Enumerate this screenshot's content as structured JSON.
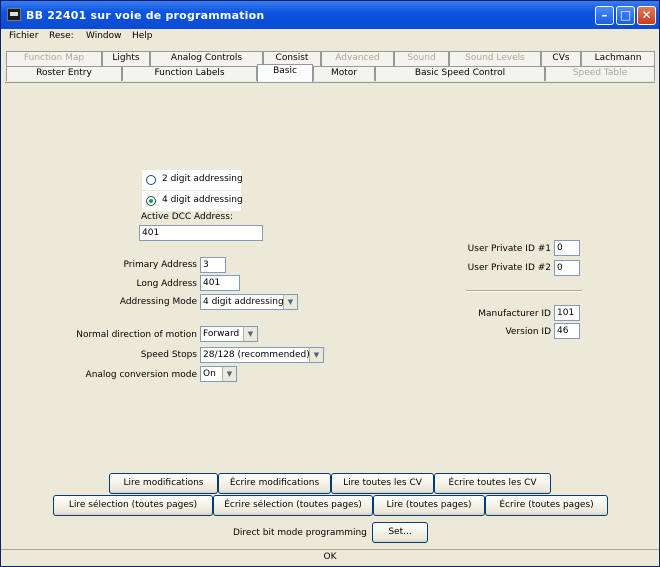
{
  "window": {
    "title": "BB 22401 sur voie de programmation"
  },
  "menu": [
    "Fichier",
    "Rese:",
    "Window",
    "Help"
  ],
  "tabs_row1": [
    {
      "label": "Function Map",
      "disabled": true
    },
    {
      "label": "Lights",
      "disabled": false
    },
    {
      "label": "Analog Controls",
      "disabled": false
    },
    {
      "label": "Consist",
      "disabled": false
    },
    {
      "label": "Advanced",
      "disabled": true
    },
    {
      "label": "Sound",
      "disabled": true
    },
    {
      "label": "Sound Levels",
      "disabled": true
    },
    {
      "label": "CVs",
      "disabled": false
    },
    {
      "label": "Lachmann",
      "disabled": false
    }
  ],
  "tabs_row2": [
    {
      "label": "Roster Entry",
      "disabled": false
    },
    {
      "label": "Function Labels",
      "disabled": false
    },
    {
      "label": "Basic",
      "selected": true
    },
    {
      "label": "Motor",
      "disabled": false
    },
    {
      "label": "Basic Speed Control",
      "disabled": false
    },
    {
      "label": "Speed Table",
      "disabled": true
    }
  ],
  "basic": {
    "radio_2digit": "2 digit addressing",
    "radio_4digit": "4 digit addressing",
    "active_dcc_label": "Active DCC Address:",
    "active_dcc_value": "401",
    "primary_label": "Primary Address",
    "primary_value": "3",
    "long_label": "Long Address",
    "long_value": "401",
    "mode_label": "Addressing Mode",
    "mode_value": "4 digit addressing",
    "direction_label": "Normal direction of motion",
    "direction_value": "Forward",
    "speedsteps_label": "Speed Stops",
    "speedsteps_value": "28/128 (recommended)",
    "analog_label": "Analog conversion mode",
    "analog_value": "On",
    "upid1_label": "User Private ID #1",
    "upid1_value": "0",
    "upid2_label": "User Private ID #2",
    "upid2_value": "0",
    "mfr_label": "Manufacturer ID",
    "mfr_value": "101",
    "version_label": "Version ID",
    "version_value": "46"
  },
  "row_buttons_1": [
    "Lire modifications",
    "Écrire modifications",
    "Lire toutes les CV",
    "Écrire toutes les CV"
  ],
  "row_buttons_2": [
    "Lire sélection (toutes pages)",
    "Écrire sélection (toutes pages)",
    "Lire (toutes pages)",
    "Écrire (toutes pages)"
  ],
  "programming": {
    "mode_label": "Direct bit mode programming",
    "set_button": "Set..."
  },
  "status": "OK"
}
